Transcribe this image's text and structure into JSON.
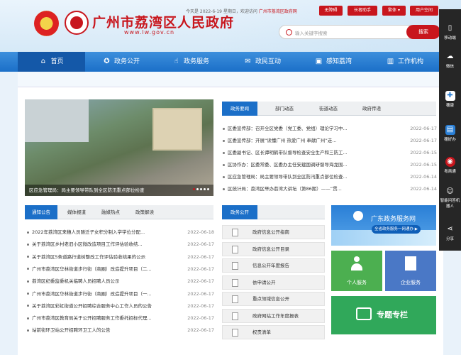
{
  "header": {
    "title": "广州市荔湾区人民政府",
    "url": "www.lw.gov.cn",
    "date": "今天是 2022-6-19 星期日，欢迎访问",
    "site_name": "广州市荔湾区政府网",
    "buttons": [
      "无障碍",
      "长者助手",
      "繁体",
      "用户空间"
    ],
    "search_placeholder": "输入关键字搜索",
    "search_button": "搜索"
  },
  "nav": [
    {
      "label": "首页",
      "icon": "home-icon"
    },
    {
      "label": "政务公开",
      "icon": "star-icon"
    },
    {
      "label": "政务服务",
      "icon": "hand-icon"
    },
    {
      "label": "政民互动",
      "icon": "chat-icon"
    },
    {
      "label": "感知荔湾",
      "icon": "image-icon"
    },
    {
      "label": "工作机构",
      "icon": "building-icon"
    }
  ],
  "sidebar": [
    {
      "label": "移动端",
      "icon": "mobile-icon"
    },
    {
      "label": "微信",
      "icon": "wechat-icon"
    },
    {
      "label": "穗康",
      "icon": "suikang-icon"
    },
    {
      "label": "穗好办",
      "icon": "suihaoban-icon"
    },
    {
      "label": "粤商通",
      "icon": "yueshangtong-icon"
    },
    {
      "label": "智能问答机器人",
      "icon": "robot-icon"
    },
    {
      "label": "分享",
      "icon": "share-icon"
    }
  ],
  "slide": {
    "caption": "区应急管理局：局主要领导带队到全区防汛重点部位检查"
  },
  "news_tabs": [
    "政务要闻",
    "部门动态",
    "街道动态",
    "政府传递"
  ],
  "news": [
    {
      "title": "区委宣传部：召开全区党委（党工委、党组）理论学习中...",
      "date": "2022-06-17"
    },
    {
      "title": "区委宣传部：开展“读懂广州 热爱广州 奉献广州”走...",
      "date": "2022-06-17"
    },
    {
      "title": "区委副书记、区长谭明鹤带队督导检查安全生产和三防工...",
      "date": "2022-06-15"
    },
    {
      "title": "区协作办：区委常委、区委办主任安建国调研督导海龙围...",
      "date": "2022-06-15"
    },
    {
      "title": "区应急管理局：局主要领导带队到全区防汛重点部位检查...",
      "date": "2022-06-14"
    },
    {
      "title": "区统计局：荔湾区举办荔湾大讲坛（第86期）——“贯...",
      "date": "2022-06-14"
    }
  ],
  "notice_tabs": [
    "通知公告",
    "媒体报道",
    "融媒热点",
    "政策解读"
  ],
  "notices": [
    {
      "title": "2022年荔湾区来穗人员随迁子女积分制入学学位分配...",
      "date": "2022-06-18"
    },
    {
      "title": "关于荔湾区乡村老旧小区微改造项目工作评估验收结...",
      "date": "2022-06-17"
    },
    {
      "title": "关于荔湾区5条道路行道树整改工作评估验收结果的公示",
      "date": "2022-06-17"
    },
    {
      "title": "广州市荔湾区华林街道步行街（商圈）改造提升项目（二...",
      "date": "2022-06-17"
    },
    {
      "title": "荔湾区纪委监委机关临聘人员招聘人员公示",
      "date": "2022-06-17"
    },
    {
      "title": "广州市荔湾区华林街道步行街（商圈）改造提升项目（一...",
      "date": "2022-06-17"
    },
    {
      "title": "关于荔湾区彩虹街道公开招聘综合服务中心工作人员的公告",
      "date": "2022-06-17"
    },
    {
      "title": "广州市荔湾区教育局关于公开招聘服务工作委托招标代理...",
      "date": "2022-06-17"
    },
    {
      "title": "站前街环卫站公开招聘环卫工人的公告",
      "date": "2022-06-17"
    }
  ],
  "open_section": {
    "title": "政务公开",
    "items": [
      "政府信息公开指南",
      "政府信息公开目录",
      "信息公开年度报告",
      "依申请公开",
      "重点领域信息公开",
      "政府网站工作年度报表",
      "权责清单"
    ]
  },
  "cards": {
    "gd_title": "广东政务服务网",
    "gd_sub": "全省政务服务一网通办 ▶",
    "personal": "个人服务",
    "enterprise": "企业服务",
    "special": "专题专栏"
  },
  "colors": {
    "brand_red": "#c8161d",
    "nav_blue": "#1b6fc8",
    "green": "#4caf50"
  }
}
